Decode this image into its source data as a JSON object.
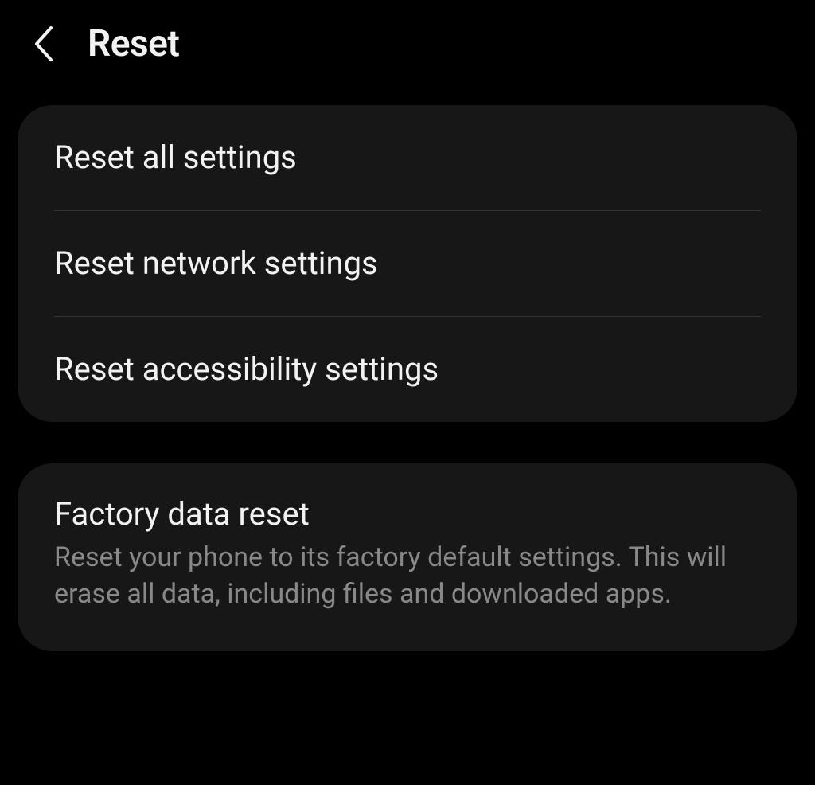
{
  "header": {
    "title": "Reset"
  },
  "panel1": {
    "items": [
      {
        "title": "Reset all settings"
      },
      {
        "title": "Reset network settings"
      },
      {
        "title": "Reset accessibility settings"
      }
    ]
  },
  "panel2": {
    "item": {
      "title": "Factory data reset",
      "description": "Reset your phone to its factory default settings. This will erase all data, including files and downloaded apps."
    }
  }
}
